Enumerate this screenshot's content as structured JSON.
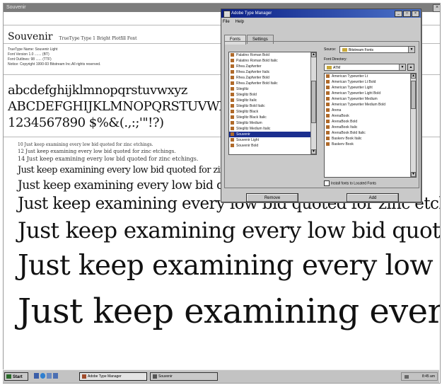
{
  "preview": {
    "title": "Souvenir",
    "close": "×",
    "font_name": "Souvenir",
    "font_desc": "TrueType Type 1 Bright Plotfill Font",
    "info": [
      "TrueType Name: Souvenir Light",
      "Font Version 1.0 ....... (BT)",
      "Font Outlines: 98 ...... (TTF)",
      "Notice: Copyright 1990-93 Bitstream Inc.All rights reserved."
    ],
    "lowercase": "abcdefghijklmnopqrstuvwxyz",
    "uppercase": "ABCDEFGHIJKLMNOPQRSTUVWXYZ",
    "numerals": "1234567890 $%&(.,:;'\"!?)",
    "small_lines": [
      "10  Just keep examining every low bid quoted for zinc etchings.",
      "12  Just keep examining every low bid quoted for zinc etchings.",
      "14  Just keep examining every low bid quoted for zinc etchings."
    ],
    "sample_lines": [
      {
        "size": "18",
        "text": "Just keep examining every low bid quoted for zinc etchings."
      },
      {
        "size": "24",
        "text": "Just keep examining every low bid quoted for zinc etchings."
      },
      {
        "size": "30",
        "text": "Just keep examining every low bid quoted for zinc etchings."
      },
      {
        "size": "36",
        "text": "Just keep examining every low bid quoted for zinc etchings."
      },
      {
        "size": "48",
        "text": "Just keep examining every low bid quoted for zinc etchings."
      },
      {
        "size": "60",
        "text": "Just keep examining every low bid quoted for zinc etchings."
      }
    ]
  },
  "dialog": {
    "title": "Adobe Type Manager",
    "menu": [
      "File",
      "Help"
    ],
    "tabs": [
      "Fonts",
      "Settings"
    ],
    "installed_fonts": [
      "Palatino Roman Bold",
      "Palatino Roman Bold Italic",
      "Rhea Zapfwriter",
      "Rhea Zapfwriter Italic",
      "Rhea Zapfwriter Bold",
      "Rhea Zapfwriter Bold Italic",
      "Stieglitz",
      "Stieglitz Bold",
      "Stieglitz Italic",
      "Stieglitz Bold Italic",
      "Stieglitz Black",
      "Stieglitz Black Italic",
      "Stieglitz Medium",
      "Stieglitz Medium Italic",
      "Souvenir",
      "Souvenir Light",
      "Souvenir Bold"
    ],
    "selected_font": "Souvenir",
    "source_label": "Source:",
    "source_value": "Bitstream Fonts",
    "folder_label": "Font Directory:",
    "folder_value": "ATM",
    "available_fonts": [
      "American Typewriter Lt",
      "American Typewriter Lt Bold",
      "American Typewriter Light",
      "American Typewriter Light Bold",
      "American Typewriter Medium",
      "American Typewriter Medium Bold",
      "Arena",
      "ArenaBook",
      "ArenaBook Bold",
      "ArenaBook Italic",
      "ArenaBook Bold Italic",
      "Baskerv Book Italic",
      "Baskerv Book"
    ],
    "checkbox_label": "Install fonts to Located Fonts",
    "remove_button": "Remove",
    "add_button": "Add",
    "title_buttons": [
      "_",
      "□",
      "×"
    ],
    "mini_buttons": [
      "▲",
      "…"
    ]
  },
  "taskbar": {
    "start": "Start",
    "tasks": [
      "Adobe Type Manager",
      "Souvenir"
    ],
    "time": "8:45 am"
  },
  "colors": {
    "title_active": "#0b1f85",
    "selection": "#1b2f8f",
    "dialog_bg": "#c9c9c9",
    "font_icon": "#b06a2a"
  }
}
